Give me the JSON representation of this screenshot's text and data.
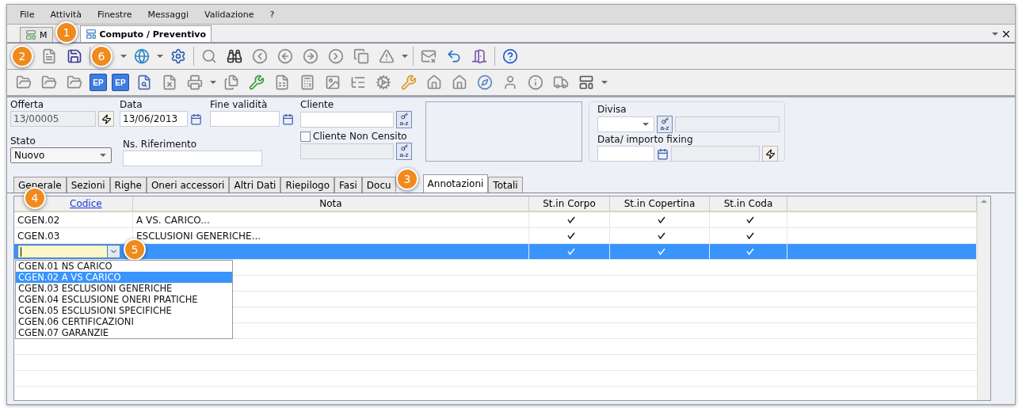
{
  "menu": [
    {
      "label": "File"
    },
    {
      "label": "Attività"
    },
    {
      "label": "Finestre"
    },
    {
      "label": "Messaggi"
    },
    {
      "label": "Validazione"
    },
    {
      "label": "?"
    }
  ],
  "doc_tabs": [
    {
      "label": "M",
      "selected": false
    },
    {
      "label": "Computo / Preventivo",
      "selected": true
    }
  ],
  "toolbar_badges": [
    "EP",
    "EP"
  ],
  "form": {
    "offerta": {
      "label": "Offerta",
      "value": "13/00005",
      "disabled": true
    },
    "data": {
      "label": "Data",
      "value": "13/06/2013"
    },
    "fine_validita": {
      "label": "Fine validità"
    },
    "cliente": {
      "label": "Cliente",
      "key_label": "a-z"
    },
    "stato": {
      "label": "Stato",
      "value": "Nuovo"
    },
    "ns_riferimento": {
      "label": "Ns. Riferimento"
    },
    "cliente_non_censito": {
      "label": "Cliente Non Censito",
      "checked": false,
      "key_label": "a-z"
    },
    "divisa": {
      "label": "Divisa",
      "key_label": "a-z"
    },
    "fixing": {
      "label": "Data/ importo fixing"
    }
  },
  "detail_tabs": [
    {
      "label": "Generale",
      "selected": false
    },
    {
      "label": "Sezioni",
      "selected": false
    },
    {
      "label": "Righe",
      "selected": false
    },
    {
      "label": "Oneri accessori",
      "selected": false
    },
    {
      "label": "Altri Dati",
      "selected": false
    },
    {
      "label": "Riepilogo",
      "selected": false
    },
    {
      "label": "Fasi",
      "selected": false
    },
    {
      "label": "Docu",
      "selected": false
    },
    {
      "label": "Annotazioni",
      "selected": true
    },
    {
      "label": "Totali",
      "selected": false
    }
  ],
  "table": {
    "columns": [
      "Codice",
      "Nota",
      "St.in Corpo",
      "St.in Copertina",
      "St.in Coda"
    ],
    "rows": [
      {
        "codice": "CGEN.02",
        "nota": "A VS. CARICO...",
        "corpo": true,
        "copertina": true,
        "coda": true,
        "selected": false
      },
      {
        "codice": "CGEN.03",
        "nota": "ESCLUSIONI GENERICHE...",
        "corpo": true,
        "copertina": true,
        "coda": true,
        "selected": false
      },
      {
        "codice": "",
        "nota": "",
        "corpo": true,
        "copertina": true,
        "coda": true,
        "selected": true
      }
    ]
  },
  "dropdown": [
    {
      "label": "CGEN.01 NS CARICO",
      "selected": false
    },
    {
      "label": "CGEN.02 A VS CARICO",
      "selected": true
    },
    {
      "label": "CGEN.03 ESCLUSIONI GENERICHE",
      "selected": false
    },
    {
      "label": "CGEN.04 ESCLUSIONE ONERI PRATICHE",
      "selected": false
    },
    {
      "label": "CGEN.05 ESCLUSIONI SPECIFICHE",
      "selected": false
    },
    {
      "label": "CGEN.06 CERTIFICAZIONI",
      "selected": false
    },
    {
      "label": "CGEN.07 GARANZIE",
      "selected": false
    }
  ],
  "callouts": [
    "1",
    "2",
    "6",
    "3",
    "4",
    "5"
  ]
}
